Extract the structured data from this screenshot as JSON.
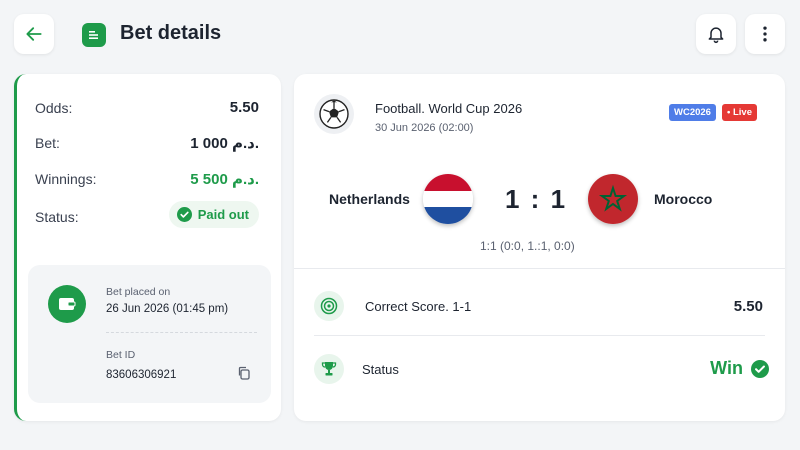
{
  "header": {
    "title": "Bet details",
    "back_icon": "arrow-left-icon",
    "bell_icon": "bell-icon",
    "more_icon": "more-vertical-icon",
    "accent": "#1e9b4a"
  },
  "summary": {
    "odds_label": "Odds:",
    "odds_value": "5.50",
    "bet_label": "Bet:",
    "bet_value": "1 000 د.م.",
    "winnings_label": "Winnings:",
    "winnings_value": "5 500 د.م.",
    "status_label": "Status:",
    "status_value": "Paid out"
  },
  "bet_info": {
    "placed_label": "Bet placed on",
    "placed_value": "26 Jun 2026 (01:45 pm)",
    "id_label": "Bet ID",
    "id_value": "83606306921"
  },
  "match": {
    "league": "Football. World Cup 2026",
    "date": "30 Jun 2026 (02:00)",
    "badge_tag": "WC2026",
    "badge_live": "• Live",
    "home_team": "Netherlands",
    "away_team": "Morocco",
    "score": "1 : 1",
    "half_scores": "1:1 (0:0, 1.:1, 0:0)"
  },
  "selection": {
    "market": "Correct Score. 1-1",
    "odds": "5.50",
    "status_label": "Status",
    "result": "Win"
  },
  "colors": {
    "green": "#1e9b4a",
    "live_red": "#e53935",
    "tag_blue": "#4f7de8"
  }
}
